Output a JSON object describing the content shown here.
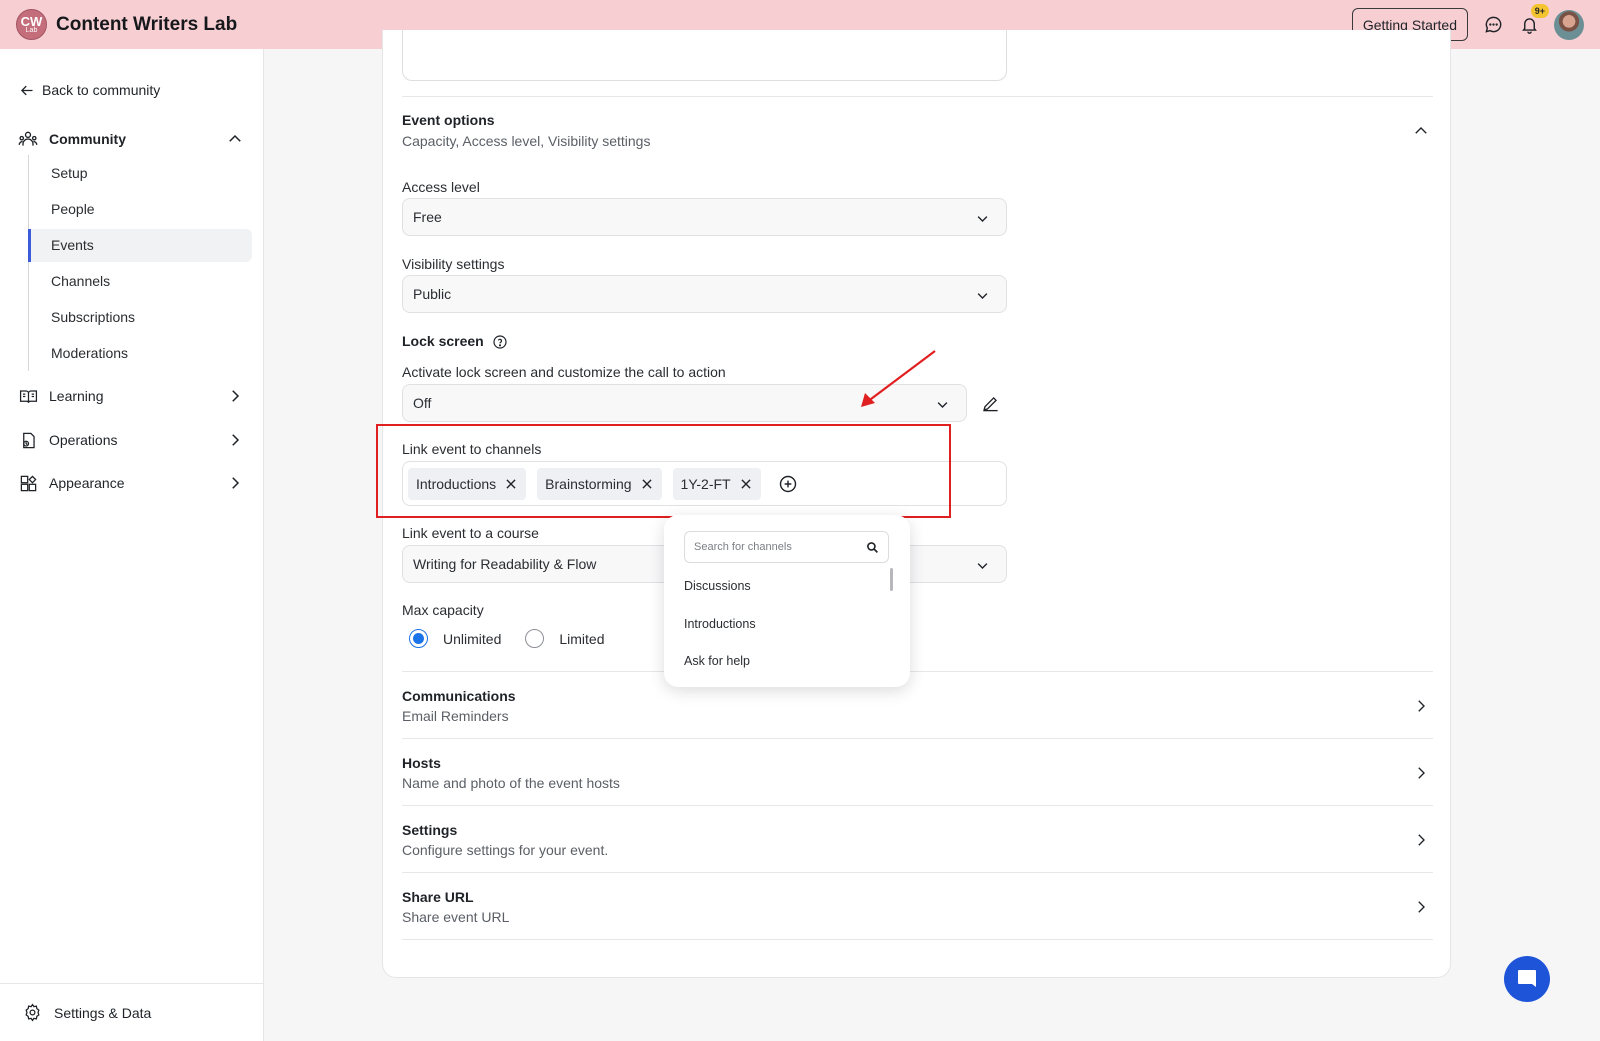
{
  "header": {
    "logo_text": "CW",
    "logo_sub": "Lab",
    "brand": "Content Writers Lab",
    "getting_started": "Getting Started",
    "notification_count": "9+"
  },
  "sidebar": {
    "back": "Back to community",
    "community": "Community",
    "community_items": [
      "Setup",
      "People",
      "Events",
      "Channels",
      "Subscriptions",
      "Moderations"
    ],
    "active_item": "Events",
    "learning": "Learning",
    "operations": "Operations",
    "appearance": "Appearance",
    "settings_data": "Settings & Data"
  },
  "event_options": {
    "title": "Event options",
    "subtitle": "Capacity, Access level, Visibility settings",
    "access_level": {
      "label": "Access level",
      "value": "Free"
    },
    "visibility": {
      "label": "Visibility settings",
      "value": "Public"
    },
    "lock_screen": {
      "title": "Lock screen",
      "label": "Activate lock screen and customize the call to action",
      "value": "Off"
    },
    "link_channels": {
      "label": "Link event to channels",
      "chips": [
        "Introductions",
        "Brainstorming",
        "1Y-2-FT"
      ]
    },
    "link_course": {
      "label": "Link event to a course",
      "value": "Writing for Readability & Flow"
    },
    "max_capacity": {
      "label": "Max capacity",
      "options": [
        "Unlimited",
        "Limited"
      ],
      "selected": "Unlimited"
    }
  },
  "channel_dropdown": {
    "placeholder": "Search for channels",
    "items": [
      "Discussions",
      "Introductions",
      "Ask for help"
    ]
  },
  "sections": [
    {
      "title": "Communications",
      "subtitle": "Email Reminders"
    },
    {
      "title": "Hosts",
      "subtitle": "Name and photo of the event hosts"
    },
    {
      "title": "Settings",
      "subtitle": "Configure settings for your event."
    },
    {
      "title": "Share URL",
      "subtitle": "Share event URL"
    }
  ],
  "colors": {
    "topbar": "#f7cfd3",
    "accent": "#3b5bdb",
    "radio": "#1a73e8",
    "highlight": "#e02020",
    "chat": "#1e55d8"
  }
}
